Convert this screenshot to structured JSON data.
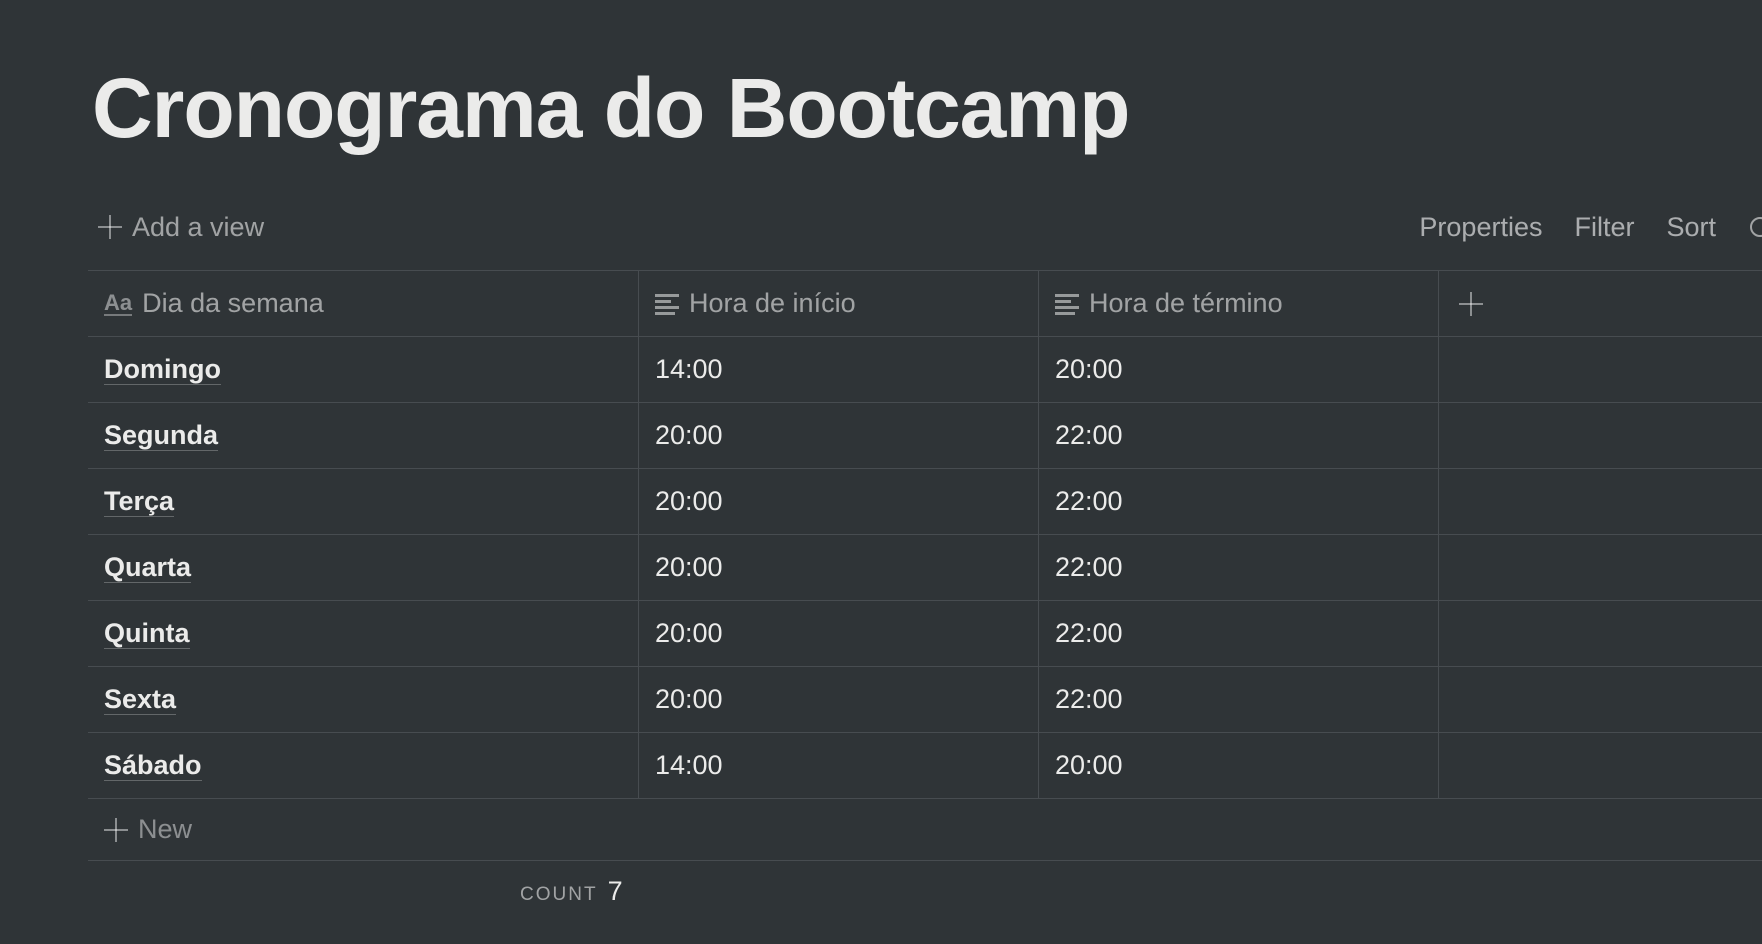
{
  "page": {
    "title": "Cronograma do Bootcamp"
  },
  "toolbar": {
    "add_view_label": "Add a view",
    "properties_label": "Properties",
    "filter_label": "Filter",
    "sort_label": "Sort"
  },
  "table": {
    "columns": [
      {
        "label": "Dia da semana",
        "icon": "text-title-icon"
      },
      {
        "label": "Hora de início",
        "icon": "text-lines-icon"
      },
      {
        "label": "Hora de término",
        "icon": "text-lines-icon"
      }
    ],
    "rows": [
      {
        "day": "Domingo",
        "start": "14:00",
        "end": "20:00"
      },
      {
        "day": "Segunda",
        "start": "20:00",
        "end": "22:00"
      },
      {
        "day": "Terça",
        "start": "20:00",
        "end": "22:00"
      },
      {
        "day": "Quarta",
        "start": "20:00",
        "end": "22:00"
      },
      {
        "day": "Quinta",
        "start": "20:00",
        "end": "22:00"
      },
      {
        "day": "Sexta",
        "start": "20:00",
        "end": "22:00"
      },
      {
        "day": "Sábado",
        "start": "14:00",
        "end": "20:00"
      }
    ],
    "new_row_label": "New"
  },
  "footer": {
    "count_label": "COUNT",
    "count_value": "7"
  }
}
